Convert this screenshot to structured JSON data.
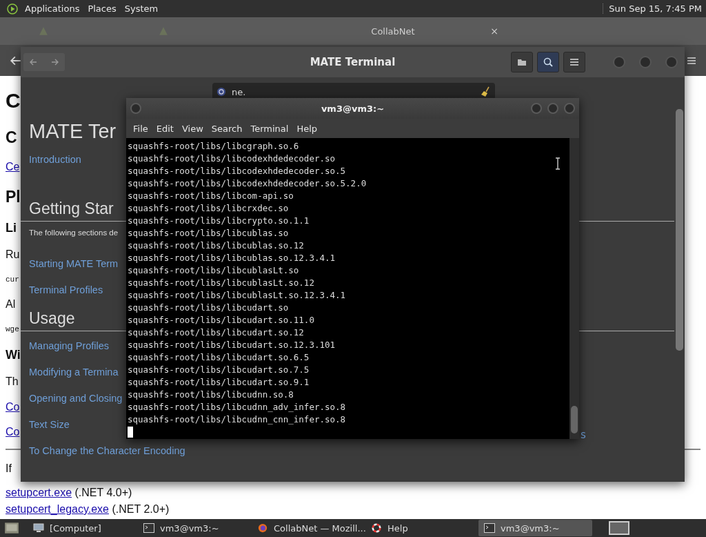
{
  "top_panel": {
    "menus": [
      "Applications",
      "Places",
      "System"
    ],
    "clock": "Sun Sep 15, 7:45 PM"
  },
  "browser": {
    "active_tab": {
      "title": "CollabNet",
      "close": "×"
    },
    "page": [
      {
        "kind": "h1",
        "text": "C"
      },
      {
        "kind": "h2",
        "text": "C"
      },
      {
        "kind": "link",
        "text": "Ce"
      },
      {
        "kind": "h2",
        "text": "Pl"
      },
      {
        "kind": "h3",
        "text": "Li"
      },
      {
        "kind": "p",
        "text": "Ru"
      },
      {
        "kind": "mono",
        "text": "cur"
      },
      {
        "kind": "p",
        "text": "Al"
      },
      {
        "kind": "mono",
        "text": "wge"
      },
      {
        "kind": "h3",
        "text": "Wi"
      },
      {
        "kind": "p",
        "text": "Th"
      },
      {
        "kind": "link",
        "text": "Co"
      },
      {
        "kind": "link",
        "text": "Co"
      },
      {
        "kind": "hr"
      },
      {
        "kind": "p",
        "text": "If"
      },
      {
        "kind": "download",
        "link": "setupcert.exe",
        "note": "(.NET 4.0+)"
      },
      {
        "kind": "download",
        "link": "setupcert_legacy.exe",
        "note": "(.NET 2.0+)"
      }
    ]
  },
  "help_window": {
    "title": "MATE Terminal",
    "search": {
      "value": "ne."
    },
    "content": [
      {
        "kind": "title",
        "text": "MATE Ter"
      },
      {
        "kind": "link",
        "text": "Introduction"
      },
      {
        "kind": "heading",
        "text": "Getting Star"
      },
      {
        "kind": "text",
        "text": "The following sections de"
      },
      {
        "kind": "link",
        "text": "Starting MATE Term"
      },
      {
        "kind": "link",
        "text": "Terminal Profiles"
      },
      {
        "kind": "heading",
        "text": "Usage"
      },
      {
        "kind": "link",
        "text": "Managing Profiles"
      },
      {
        "kind": "link",
        "text": "Modifying a Termina"
      },
      {
        "kind": "link",
        "text": "Opening and Closing"
      },
      {
        "kind": "link",
        "text": "Text Size"
      },
      {
        "kind": "link",
        "text": "To Change the Character Encoding"
      }
    ],
    "fragment": "s"
  },
  "terminal": {
    "title": "vm3@vm3:~",
    "menus": [
      "File",
      "Edit",
      "View",
      "Search",
      "Terminal",
      "Help"
    ],
    "lines": [
      "squashfs-root/libs/libcgraph.so.6",
      "squashfs-root/libs/libcodexhdedecoder.so",
      "squashfs-root/libs/libcodexhdedecoder.so.5",
      "squashfs-root/libs/libcodexhdedecoder.so.5.2.0",
      "squashfs-root/libs/libcom-api.so",
      "squashfs-root/libs/libcrxdec.so",
      "squashfs-root/libs/libcrypto.so.1.1",
      "squashfs-root/libs/libcublas.so",
      "squashfs-root/libs/libcublas.so.12",
      "squashfs-root/libs/libcublas.so.12.3.4.1",
      "squashfs-root/libs/libcublasLt.so",
      "squashfs-root/libs/libcublasLt.so.12",
      "squashfs-root/libs/libcublasLt.so.12.3.4.1",
      "squashfs-root/libs/libcudart.so",
      "squashfs-root/libs/libcudart.so.11.0",
      "squashfs-root/libs/libcudart.so.12",
      "squashfs-root/libs/libcudart.so.12.3.101",
      "squashfs-root/libs/libcudart.so.6.5",
      "squashfs-root/libs/libcudart.so.7.5",
      "squashfs-root/libs/libcudart.so.9.1",
      "squashfs-root/libs/libcudnn.so.8",
      "squashfs-root/libs/libcudnn_adv_infer.so.8",
      "squashfs-root/libs/libcudnn_cnn_infer.so.8"
    ]
  },
  "taskbar": [
    {
      "kind": "folder",
      "label": "[Computer]",
      "selected": false
    },
    {
      "kind": "terminal",
      "label": "vm3@vm3:~",
      "selected": false
    },
    {
      "kind": "firefox",
      "label": "CollabNet — Mozill...",
      "selected": false
    },
    {
      "kind": "help",
      "label": "Help",
      "selected": false
    },
    {
      "kind": "terminal",
      "label": "vm3@vm3:~",
      "selected": true
    }
  ]
}
